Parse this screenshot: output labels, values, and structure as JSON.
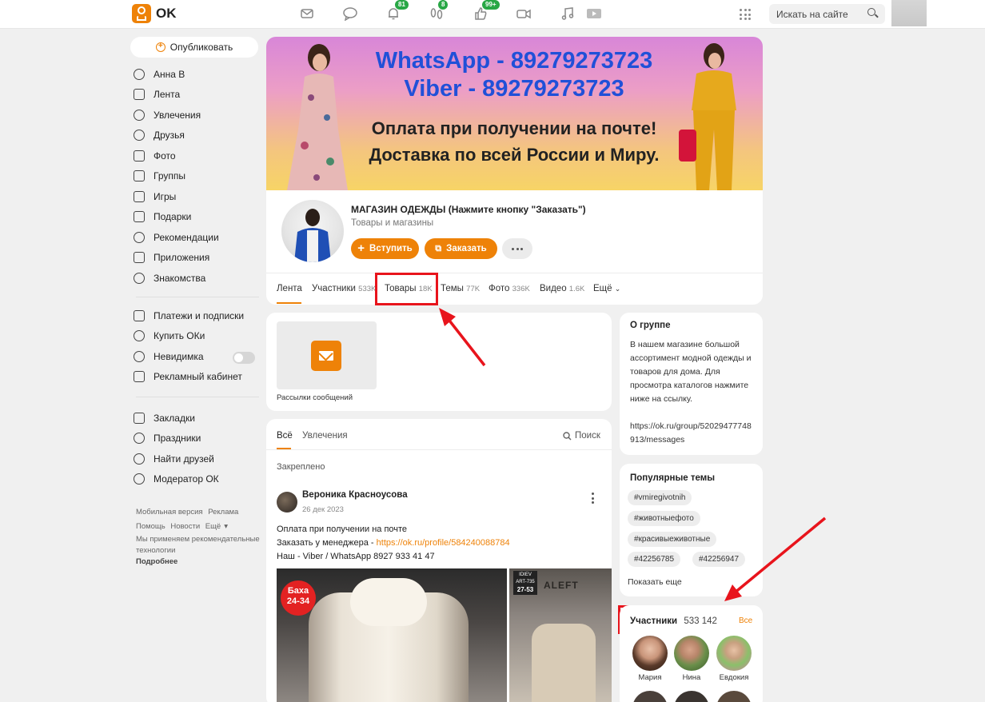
{
  "header": {
    "logo_text": "OK",
    "badges": {
      "notifications": "81",
      "guests": "8",
      "likes": "99+"
    },
    "search_placeholder": "Искать на сайте"
  },
  "sidebar": {
    "publish_label": "Опубликовать",
    "items": [
      {
        "label": "Анна В",
        "icon": "user-icon"
      },
      {
        "label": "Лента",
        "icon": "home-icon"
      },
      {
        "label": "Увлечения",
        "icon": "hobby-icon"
      },
      {
        "label": "Друзья",
        "icon": "friends-icon"
      },
      {
        "label": "Фото",
        "icon": "photo-icon"
      },
      {
        "label": "Группы",
        "icon": "groups-icon"
      },
      {
        "label": "Игры",
        "icon": "gamepad-icon"
      },
      {
        "label": "Подарки",
        "icon": "gift-icon"
      },
      {
        "label": "Рекомендации",
        "icon": "compass-icon"
      },
      {
        "label": "Приложения",
        "icon": "apps-icon"
      },
      {
        "label": "Знакомства",
        "icon": "hearts-icon"
      }
    ],
    "items2": [
      {
        "label": "Платежи и подписки",
        "icon": "wallet-icon"
      },
      {
        "label": "Купить ОКи",
        "icon": "coin-icon"
      },
      {
        "label": "Невидимка",
        "icon": "invisible-icon"
      },
      {
        "label": "Рекламный кабинет",
        "icon": "megaphone-icon"
      }
    ],
    "items3": [
      {
        "label": "Закладки",
        "icon": "bookmark-icon"
      },
      {
        "label": "Праздники",
        "icon": "balloon-icon"
      },
      {
        "label": "Найти друзей",
        "icon": "add-user-icon"
      },
      {
        "label": "Модератор ОК",
        "icon": "moderator-icon"
      }
    ],
    "footer": {
      "mobile": "Мобильная версия",
      "ads": "Реклама",
      "help": "Помощь",
      "news": "Новости",
      "more": "Ещё",
      "notice": "Мы применяем рекомендательные технологии",
      "details": "Подробнее"
    }
  },
  "banner": {
    "line1": "WhatsApp - 89279273723",
    "line2": "Viber - 89279273723",
    "line3": "Оплата при получении на почте!",
    "line4": "Доставка по всей России и Миру."
  },
  "group": {
    "title": "МАГАЗИН ОДЕЖДЫ (Нажмите кнопку \"Заказать\")",
    "category": "Товары и магазины",
    "join_label": "Вступить",
    "order_label": "Заказать",
    "tabs": [
      {
        "label": "Лента",
        "count": ""
      },
      {
        "label": "Участники",
        "count": "533K"
      },
      {
        "label": "Товары",
        "count": "18K"
      },
      {
        "label": "Темы",
        "count": "77K"
      },
      {
        "label": "Фото",
        "count": "336K"
      },
      {
        "label": "Видео",
        "count": "1.6K"
      },
      {
        "label": "Ещё",
        "count": ""
      }
    ]
  },
  "messages_tile": {
    "label": "Рассылки сообщений"
  },
  "feed": {
    "tab_all": "Всё",
    "tab_hobbies": "Увлечения",
    "search_label": "Поиск",
    "pinned_label": "Закреплено",
    "post": {
      "author": "Вероника Красноусова",
      "date": "26 дек 2023",
      "line1": "Оплата при получении на почте",
      "line2_prefix": "Заказать у менеджера - ",
      "line2_link": "https://ok.ru/profile/584240088784",
      "line3": "Наш - Viber / WhatsApp 8927 933 41 47",
      "photo1_badge_top": "Баха",
      "photo1_badge_bottom": "24-34",
      "photo2_tag_brand": "IDIEV",
      "photo2_tag_art": "ART-735",
      "photo2_tag_size": "27-53",
      "photo2_brand": "ALEFT"
    }
  },
  "about": {
    "title": "О группе",
    "text": "В нашем магазине большой ассортимент модной одежды и товаров для дома. Для просмотра каталогов нажмите ниже на ссылку.",
    "url": "https://ok.ru/group/52029477748913/messages"
  },
  "topics": {
    "title": "Популярные темы",
    "chips": [
      "#vmiregivotnih",
      "#животныефото",
      "#красивыеживотные",
      "#42256785",
      "#42256947"
    ],
    "show_more": "Показать еще"
  },
  "members": {
    "title": "Участники",
    "count": "533 142",
    "all_label": "Все",
    "people": [
      {
        "name": "Мария"
      },
      {
        "name": "Нина"
      },
      {
        "name": "Евдокия"
      }
    ]
  },
  "annotation_color": "#e8141c",
  "accent_color": "#ee8208"
}
